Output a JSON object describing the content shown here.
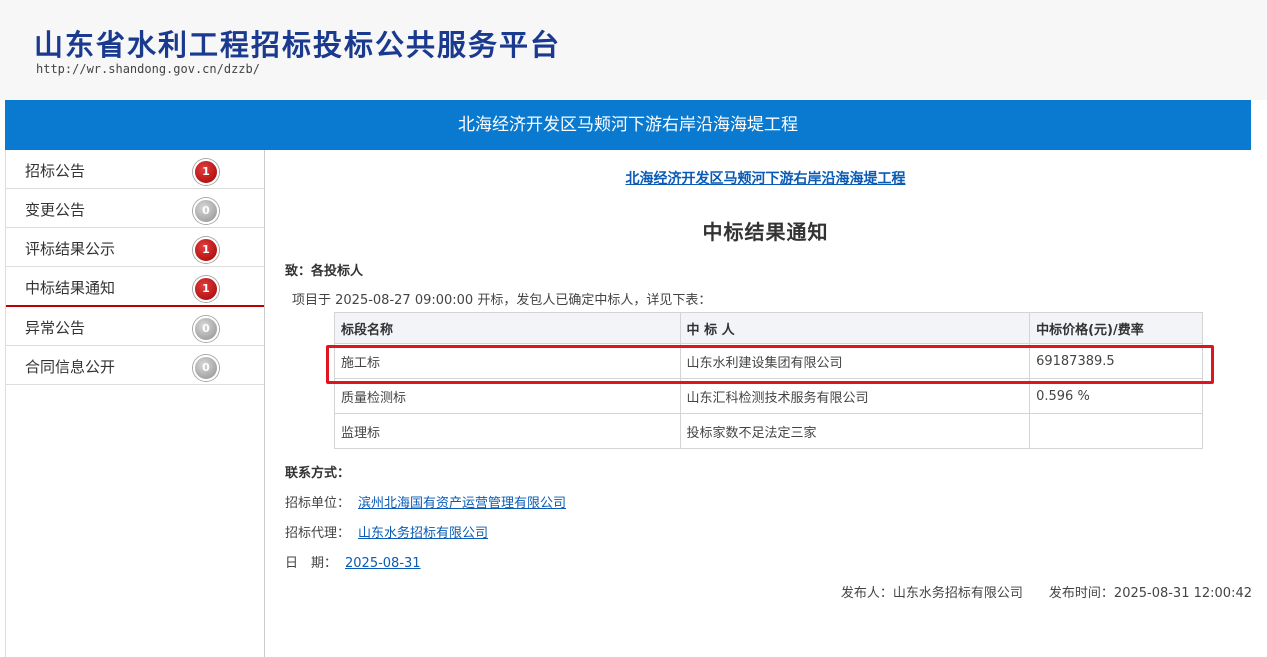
{
  "header": {
    "title": "山东省水利工程招标投标公共服务平台",
    "url": "http://wr.shandong.gov.cn/dzzb/"
  },
  "banner": {
    "title": "北海经济开发区马颊河下游右岸沿海海堤工程"
  },
  "sidebar": {
    "items": [
      {
        "label": "招标公告",
        "count": "1",
        "badge": "red"
      },
      {
        "label": "变更公告",
        "count": "0",
        "badge": "gray"
      },
      {
        "label": "评标结果公示",
        "count": "1",
        "badge": "red"
      },
      {
        "label": "中标结果通知",
        "count": "1",
        "badge": "red",
        "active": true
      },
      {
        "label": "异常公告",
        "count": "0",
        "badge": "gray"
      },
      {
        "label": "合同信息公开",
        "count": "0",
        "badge": "gray"
      }
    ]
  },
  "main": {
    "project_link": "北海经济开发区马颊河下游右岸沿海海堤工程",
    "notice_title": "中标结果通知",
    "to": "致：各投标人",
    "intro": "项目于 2025-08-27 09:00:00 开标，发包人已确定中标人，详见下表：",
    "table": {
      "headers": [
        "标段名称",
        "中 标 人",
        "中标价格(元)/费率"
      ],
      "rows": [
        [
          "施工标",
          "山东水利建设集团有限公司",
          "69187389.5"
        ],
        [
          "质量检测标",
          "山东汇科检测技术服务有限公司",
          "0.596 %"
        ],
        [
          "监理标",
          "投标家数不足法定三家",
          ""
        ]
      ]
    },
    "contact": {
      "heading": "联系方式：",
      "tenderer_label": "招标单位：",
      "tenderer": "滨州北海国有资产运营管理有限公司",
      "agent_label": "招标代理：",
      "agent": "山东水务招标有限公司",
      "date_label": "日　期：",
      "date": "2025-08-31"
    },
    "footer": {
      "publisher": "发布人：山东水务招标有限公司",
      "publish_time": "发布时间：2025-08-31 12:00:42"
    }
  },
  "colors": {
    "banner": "#0a7ad0",
    "title": "#1a3a8f",
    "link": "#0a5bb5",
    "highlight": "#e0141e",
    "badge_red": "#c00000"
  }
}
